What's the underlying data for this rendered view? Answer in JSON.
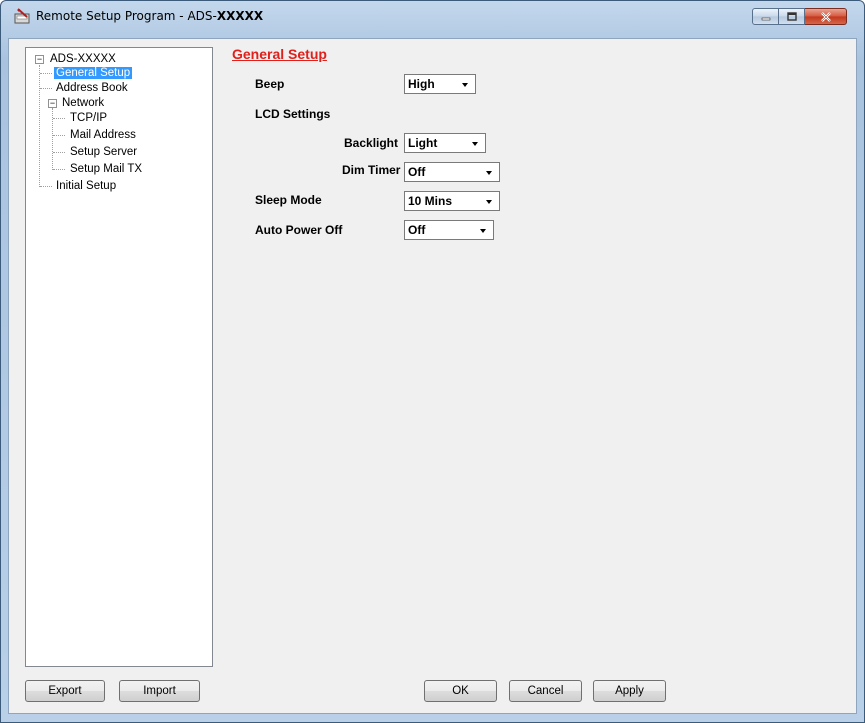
{
  "window": {
    "title_prefix": "Remote Setup Program - ADS-",
    "title_suffix": "XXXXX",
    "icon": "remote-setup-app-icon",
    "caption": {
      "minimize_icon": "minimize-icon",
      "maximize_icon": "maximize-icon",
      "close_icon": "close-icon"
    }
  },
  "tree": {
    "root": "ADS-XXXXX",
    "items": {
      "general_setup": "General Setup",
      "address_book": "Address Book",
      "network": "Network",
      "tcp_ip": "TCP/IP",
      "mail_address": "Mail Address",
      "setup_server": "Setup Server",
      "setup_mail_tx": "Setup Mail TX",
      "initial_setup": "Initial Setup"
    },
    "selected": "General Setup"
  },
  "main": {
    "section_title": "General Setup",
    "beep": {
      "label": "Beep",
      "value": "High"
    },
    "lcd_settings": {
      "label": "LCD Settings"
    },
    "backlight": {
      "label": "Backlight",
      "value": "Light"
    },
    "dim_timer": {
      "label": "Dim Timer",
      "value": "Off"
    },
    "sleep_mode": {
      "label": "Sleep Mode",
      "value": "10 Mins"
    },
    "auto_power_off": {
      "label": "Auto Power Off",
      "value": "Off"
    }
  },
  "buttons": {
    "export": "Export",
    "import": "Import",
    "ok": "OK",
    "cancel": "Cancel",
    "apply": "Apply"
  }
}
